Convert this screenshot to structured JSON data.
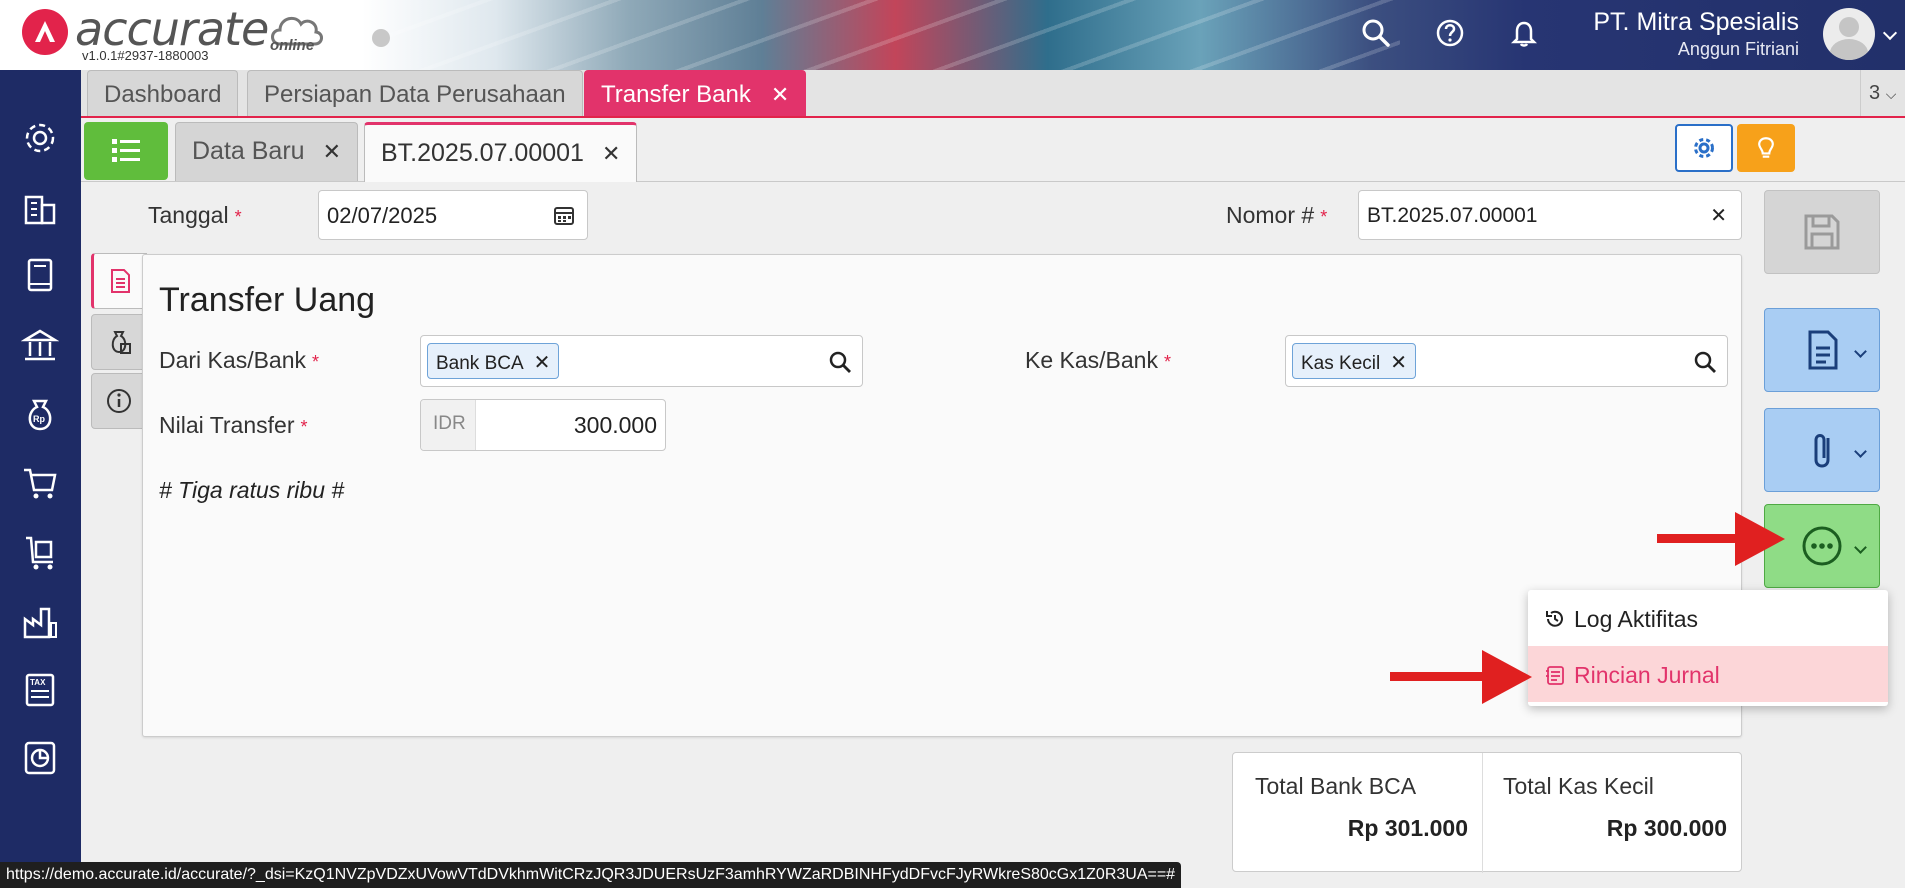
{
  "header": {
    "logo_text": "accurate",
    "logo_online": "online",
    "version": "v1.0.1#2937-1880003",
    "company": "PT. Mitra Spesialis",
    "user": "Anggun Fitriani"
  },
  "main_tabs": [
    {
      "label": "Dashboard"
    },
    {
      "label": "Persiapan Data Perusahaan"
    },
    {
      "label": "Transfer Bank"
    }
  ],
  "tab_count": "3",
  "sub_tabs": [
    {
      "label": "Data Baru"
    },
    {
      "label": "BT.2025.07.00001"
    }
  ],
  "form": {
    "tanggal_label": "Tanggal",
    "tanggal_value": "02/07/2025",
    "nomor_label": "Nomor #",
    "nomor_value": "BT.2025.07.00001",
    "required_mark": "*"
  },
  "card": {
    "title": "Transfer Uang",
    "dari_label": "Dari Kas/Bank",
    "dari_value": "Bank BCA",
    "ke_label": "Ke Kas/Bank",
    "ke_value": "Kas Kecil",
    "nilai_label": "Nilai Transfer",
    "currency": "IDR",
    "nilai_value": "300.000",
    "terbilang": "# Tiga ratus ribu #"
  },
  "dropdown": {
    "items": [
      {
        "label": "Log Aktifitas"
      },
      {
        "label": "Rincian Jurnal"
      }
    ]
  },
  "totals": [
    {
      "label": "Total Bank BCA",
      "value": "Rp 301.000"
    },
    {
      "label": "Total Kas Kecil",
      "value": "Rp 300.000"
    }
  ],
  "status_url": "https://demo.accurate.id/accurate/?_dsi=KzQ1NVZpVDZxUVowVTdDVkhmWitCRzJQR3JDUERsUzF3amhRYWZaRDBINHFydDFvcFJyRWkreS80cGx1Z0R3UA==#",
  "colors": {
    "accent": "#e2336b",
    "sidebar": "#1e2b65",
    "green": "#60bd3c",
    "blue_btn": "#a9cdf3",
    "green_btn": "#8fdc86",
    "arrow": "#e02020"
  }
}
